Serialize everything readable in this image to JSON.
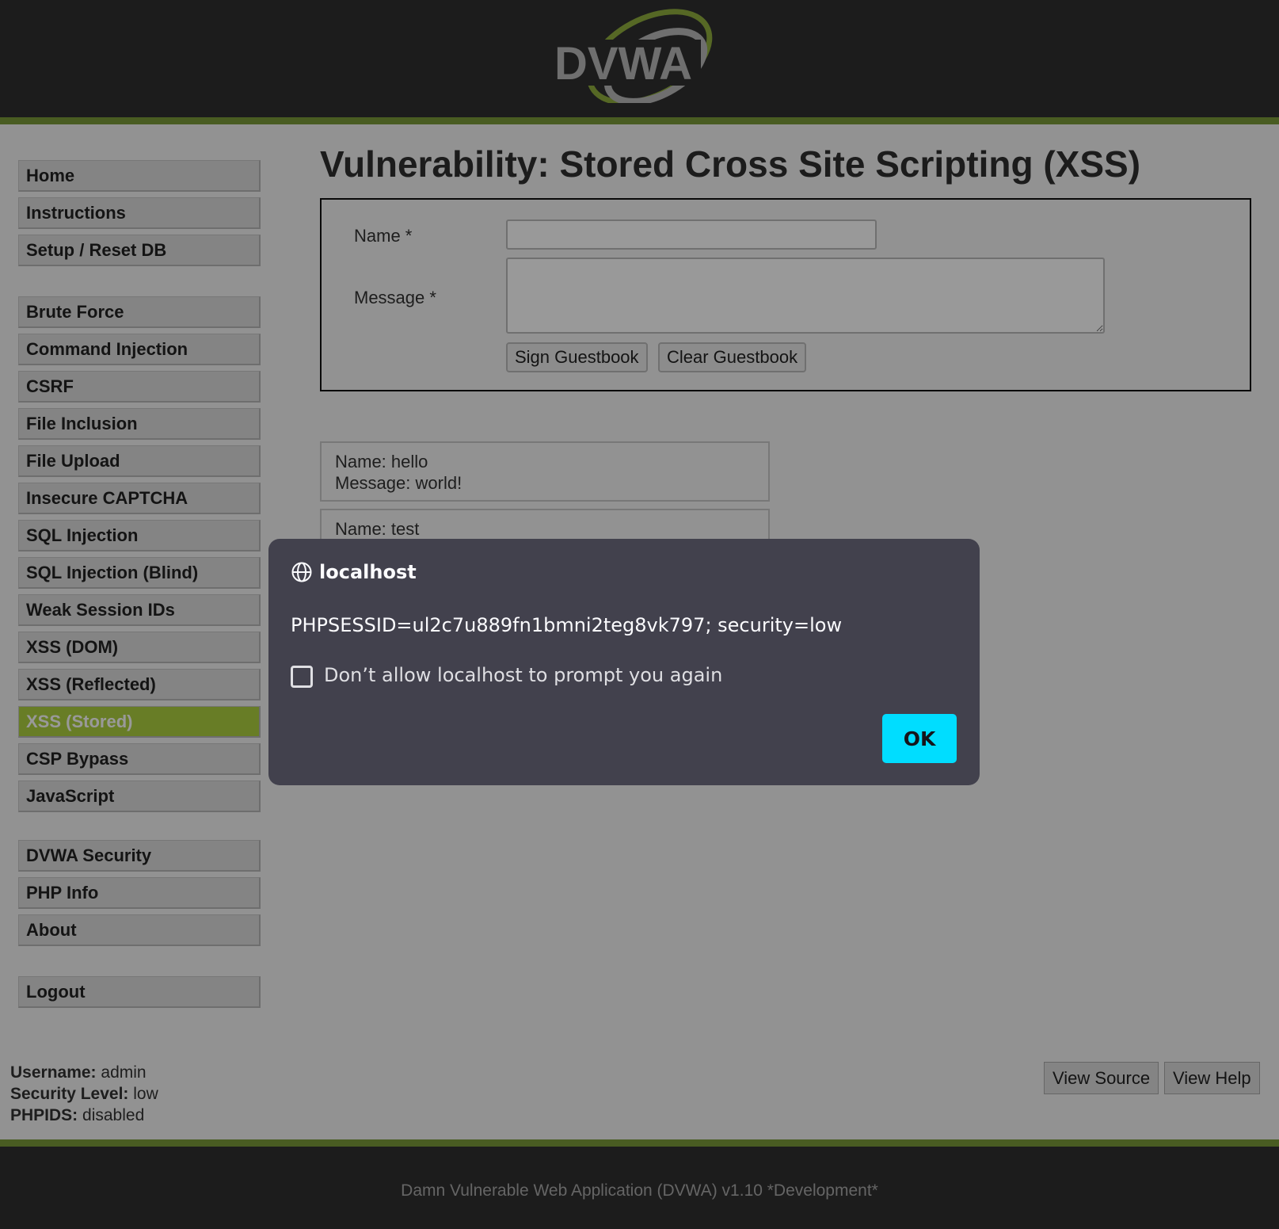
{
  "header": {
    "logo_text": "DVWA",
    "logo_icon": "dvwa-swoosh-logo"
  },
  "sidebar": {
    "groups": [
      [
        "Home",
        "Instructions",
        "Setup / Reset DB"
      ],
      [
        "Brute Force",
        "Command Injection",
        "CSRF",
        "File Inclusion",
        "File Upload",
        "Insecure CAPTCHA",
        "SQL Injection",
        "SQL Injection (Blind)",
        "Weak Session IDs",
        "XSS (DOM)",
        "XSS (Reflected)",
        "XSS (Stored)",
        "CSP Bypass",
        "JavaScript"
      ],
      [
        "DVWA Security",
        "PHP Info",
        "About"
      ],
      [
        "Logout"
      ]
    ],
    "selected": "XSS (Stored)"
  },
  "main": {
    "title": "Vulnerability: Stored Cross Site Scripting (XSS)",
    "form": {
      "name_label": "Name *",
      "name_value": "",
      "message_label": "Message *",
      "message_value": "",
      "sign_button": "Sign Guestbook",
      "clear_button": "Clear Guestbook"
    },
    "entries": [
      {
        "name": "Name: hello",
        "message": "Message: world!"
      },
      {
        "name": "Name: test",
        "message": ""
      }
    ]
  },
  "status": {
    "username_label": "Username:",
    "username_value": "admin",
    "security_label": "Security Level:",
    "security_value": "low",
    "phpids_label": "PHPIDS:",
    "phpids_value": "disabled"
  },
  "source_buttons": {
    "view_source": "View Source",
    "view_help": "View Help"
  },
  "footer": {
    "text": "Damn Vulnerable Web Application (DVWA) v1.10 *Development*"
  },
  "dialog": {
    "origin": "localhost",
    "origin_icon": "globe-icon",
    "message": "PHPSESSID=ul2c7u889fn1bmni2teg8vk797; security=low",
    "checkbox_label": "Don’t allow localhost to prompt you again",
    "checkbox_checked": false,
    "ok_label": "OK"
  },
  "colors": {
    "header_bg": "#2f2f2f",
    "accent_green": "#7a9a3a",
    "selected_menu": "#aed140",
    "dialog_bg": "#42414d",
    "ok_button": "#00ddff"
  }
}
